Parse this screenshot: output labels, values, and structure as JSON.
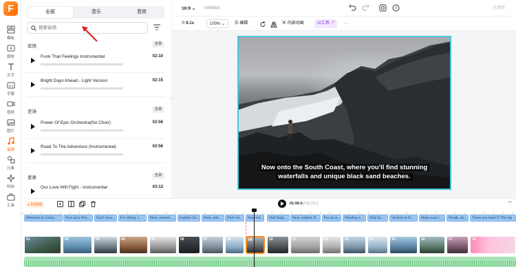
{
  "rail": {
    "items": [
      {
        "label": "模板",
        "icon": "template-icon"
      },
      {
        "label": "媒体",
        "icon": "media-icon"
      },
      {
        "label": "文字",
        "icon": "text-icon"
      },
      {
        "label": "字幕",
        "icon": "subtitle-icon"
      },
      {
        "label": "视频",
        "icon": "video-icon"
      },
      {
        "label": "图片",
        "icon": "image-icon"
      },
      {
        "label": "音频",
        "icon": "music-icon"
      },
      {
        "label": "元素",
        "icon": "element-icon"
      },
      {
        "label": "特效",
        "icon": "effects-icon"
      },
      {
        "label": "工具",
        "icon": "tools-icon"
      }
    ],
    "active_index": 6
  },
  "panel": {
    "tabs": [
      "全部",
      "音乐",
      "音效"
    ],
    "active_tab": 0,
    "search_placeholder": "搜索音频",
    "sections": [
      {
        "title": "欢快",
        "all_label": "全部",
        "tracks": [
          {
            "name": "Funk That Feelings Instrumental",
            "duration": "02:10"
          },
          {
            "name": "Bright Days Ahead - Light Version",
            "duration": "02:15"
          }
        ]
      },
      {
        "title": "史诗",
        "all_label": "全部",
        "tracks": [
          {
            "name": "Power Of Epic Orchestra(No Choir)",
            "duration": "02:56"
          },
          {
            "name": "Road To The Adventure (Instrumental)",
            "duration": "02:56"
          }
        ]
      },
      {
        "title": "爱意",
        "all_label": "全部",
        "tracks": [
          {
            "name": "Our Love Will Fight - Instrumental",
            "duration": "03:13"
          }
        ]
      }
    ]
  },
  "topbar": {
    "ratio": "16:9",
    "title": "Untitled",
    "saved_label": "已保存"
  },
  "toolbar": {
    "duration": "6.1s",
    "zoom": "100%",
    "edit_label": "编辑",
    "animation_label": "内部动画",
    "ai_label": "AI工具"
  },
  "canvas": {
    "caption_line1": "Now onto the South Coast, where you'll find stunning",
    "caption_line2": "waterfalls and unique black sand beaches.",
    "border_color": "#45c8d8"
  },
  "timeline": {
    "tag": "时间线",
    "current_time": "01:06.0",
    "total_time": "02:22.2",
    "subtitles": [
      "Welcome to Icelan...",
      "First up is Rey...",
      "Don't miss...",
      "For dining, t...",
      "Next, venture ...",
      "Explore Gu...",
      "Next, witn...",
      "Don't mi...",
      "Now ont...",
      "Visit Selja...",
      "Next, explore R...",
      "For acco...",
      "Heading e...",
      "Stop by ...",
      "Venture to th...",
      "Make sure t...",
      "Finally, do...",
      "There you have it! The top"
    ],
    "clips": [
      "01",
      "02",
      "03",
      "04",
      "05",
      "06",
      "07",
      "08",
      "09",
      "10",
      "11",
      "12",
      "13",
      "14",
      "15",
      "16",
      "17",
      "18"
    ],
    "selected_clip": 8
  },
  "colors": {
    "accent": "#ff6a00",
    "subtitle_fill": "#9cc7f2",
    "audio_fill": "#a6e3b4"
  }
}
